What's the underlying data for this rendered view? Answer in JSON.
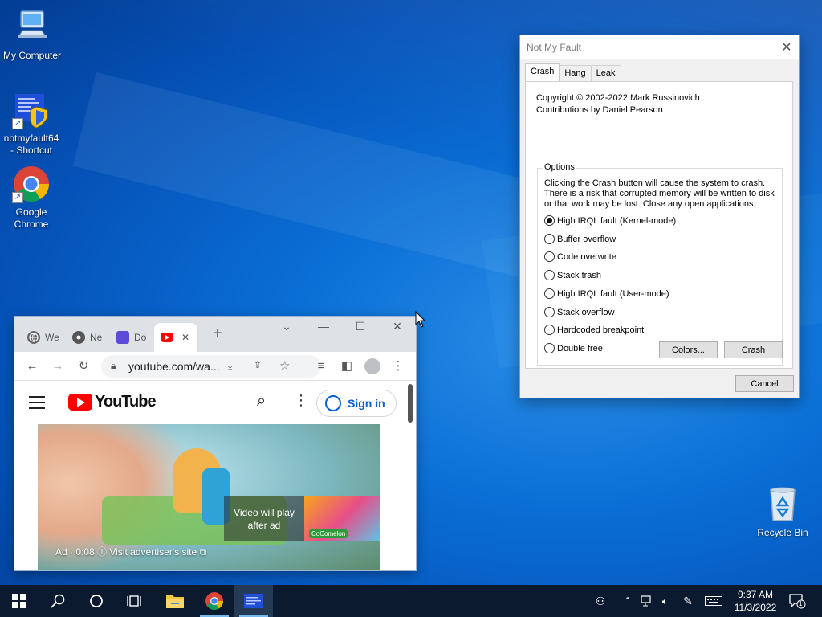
{
  "desktop": {
    "icons": [
      {
        "label": "My Computer",
        "icon": "computer-icon"
      },
      {
        "label": "notmyfault64\n- Shortcut",
        "icon": "notmyfault-icon"
      },
      {
        "label": "Google\nChrome",
        "icon": "chrome-icon"
      },
      {
        "label": "Recycle Bin",
        "icon": "recycle-bin-icon"
      }
    ]
  },
  "nmf": {
    "title": "Not My Fault",
    "tabs": [
      "Crash",
      "Hang",
      "Leak"
    ],
    "copyright": "Copyright © 2002-2022 Mark Russinovich",
    "contributions": "Contributions by Daniel Pearson",
    "options_legend": "Options",
    "description": "Clicking the Crash button will cause the system to crash. There is a risk that corrupted memory will be written to disk or that work may be lost. Close any open applications.",
    "options": [
      {
        "label": "High IRQL fault (Kernel-mode)",
        "selected": true
      },
      {
        "label": "Buffer overflow",
        "selected": false
      },
      {
        "label": "Code overwrite",
        "selected": false
      },
      {
        "label": "Stack trash",
        "selected": false
      },
      {
        "label": "High IRQL fault (User-mode)",
        "selected": false
      },
      {
        "label": "Stack overflow",
        "selected": false
      },
      {
        "label": "Hardcoded breakpoint",
        "selected": false
      },
      {
        "label": "Double free",
        "selected": false
      }
    ],
    "colors_button": "Colors...",
    "crash_button": "Crash",
    "cancel_button": "Cancel"
  },
  "chrome": {
    "tabs": [
      {
        "label": "We",
        "icon": "globe-icon"
      },
      {
        "label": "Ne",
        "icon": "chrome-icon"
      },
      {
        "label": "Do",
        "icon": "docs-icon"
      },
      {
        "label": "",
        "icon": "youtube-icon",
        "active": true
      }
    ],
    "new_tab": "+",
    "url": "youtube.com/wa...",
    "youtube": {
      "logo_text": "YouTube",
      "sign_in": "Sign in",
      "overlay_line1": "Video will play",
      "overlay_line2": "after ad",
      "ad_text": "Ad · 0:08  ⓘ  Visit advertiser's site ⧉",
      "badge": "CoComelon"
    }
  },
  "taskbar": {
    "time": "9:37 AM",
    "date": "11/3/2022",
    "notification_count": "1"
  },
  "colors": {
    "desktop_blue": "#0a6fd6",
    "taskbar": "#0b1a2e",
    "youtube_red": "#ff0000",
    "signin_blue": "#065fd4"
  }
}
